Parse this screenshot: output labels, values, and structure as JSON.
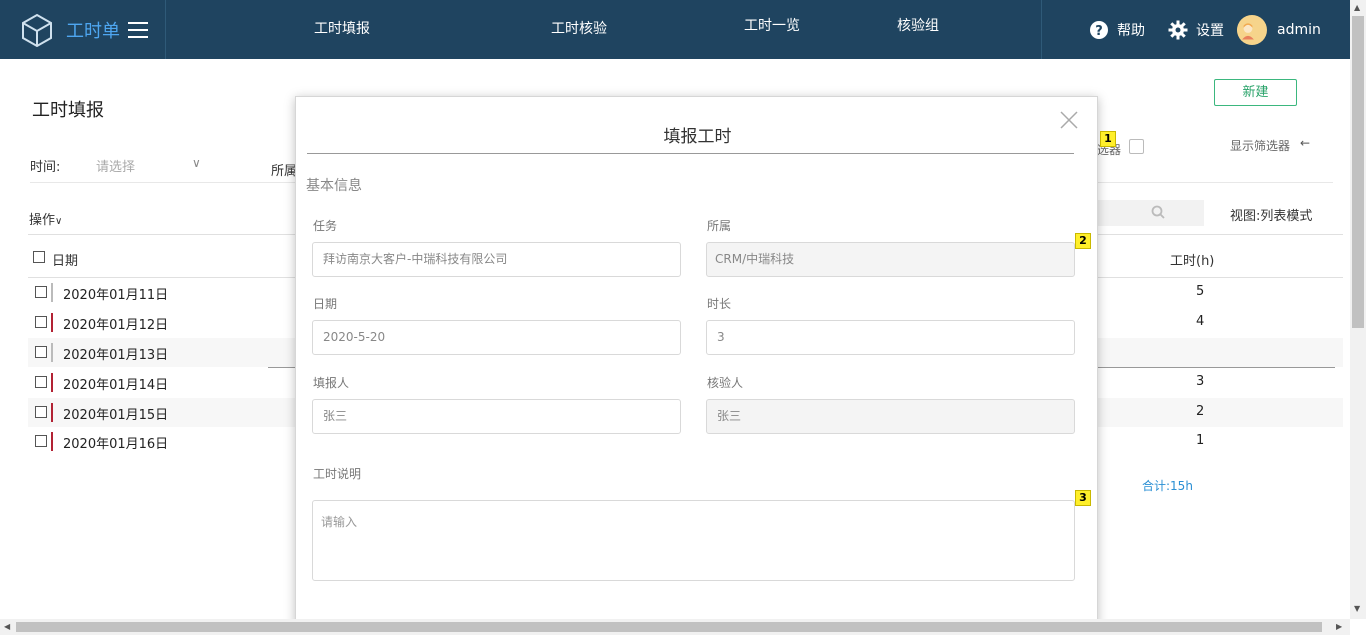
{
  "app": {
    "title": "工时单"
  },
  "nav": [
    "工时填报",
    "工时核验",
    "工时一览",
    "核验组"
  ],
  "tools": {
    "help": "帮助",
    "settings": "设置",
    "user": "admin"
  },
  "page": {
    "title": "工时填报",
    "new_button": "新建",
    "filter_time_label": "时间:",
    "filter_time_placeholder": "请选择",
    "filter_belong_label": "所属",
    "filter_partial": "选器",
    "show_filter": "显示筛选器",
    "ops": "操作",
    "view_mode": "视图:列表模式",
    "col_date": "日期",
    "col_hours": "工时(h)",
    "total": "合计:15h"
  },
  "rows": [
    {
      "date": "2020年01月11日",
      "hours": "5"
    },
    {
      "date": "2020年01月12日",
      "hours": "4"
    },
    {
      "date": "2020年01月13日",
      "hours": ""
    },
    {
      "date": "2020年01月14日",
      "hours": "3"
    },
    {
      "date": "2020年01月15日",
      "hours": "2"
    },
    {
      "date": "2020年01月16日",
      "hours": "1"
    }
  ],
  "modal": {
    "title": "填报工时",
    "section": "基本信息",
    "task_label": "任务",
    "task_value": "拜访南京大客户-中瑞科技有限公司",
    "belong_label": "所属",
    "belong_value": "CRM/中瑞科技",
    "date_label": "日期",
    "date_value": "2020-5-20",
    "duration_label": "时长",
    "duration_value": "3",
    "reporter_label": "填报人",
    "reporter_value": "张三",
    "verifier_label": "核验人",
    "verifier_value": "张三",
    "desc_label": "工时说明",
    "desc_placeholder": "请输入"
  },
  "badges": [
    "1",
    "2",
    "3"
  ],
  "colors": {
    "topbar": "#1f4460",
    "accent": "#4ea6f0",
    "new_button": "#3bb77e",
    "row_marker": "#b22234"
  }
}
